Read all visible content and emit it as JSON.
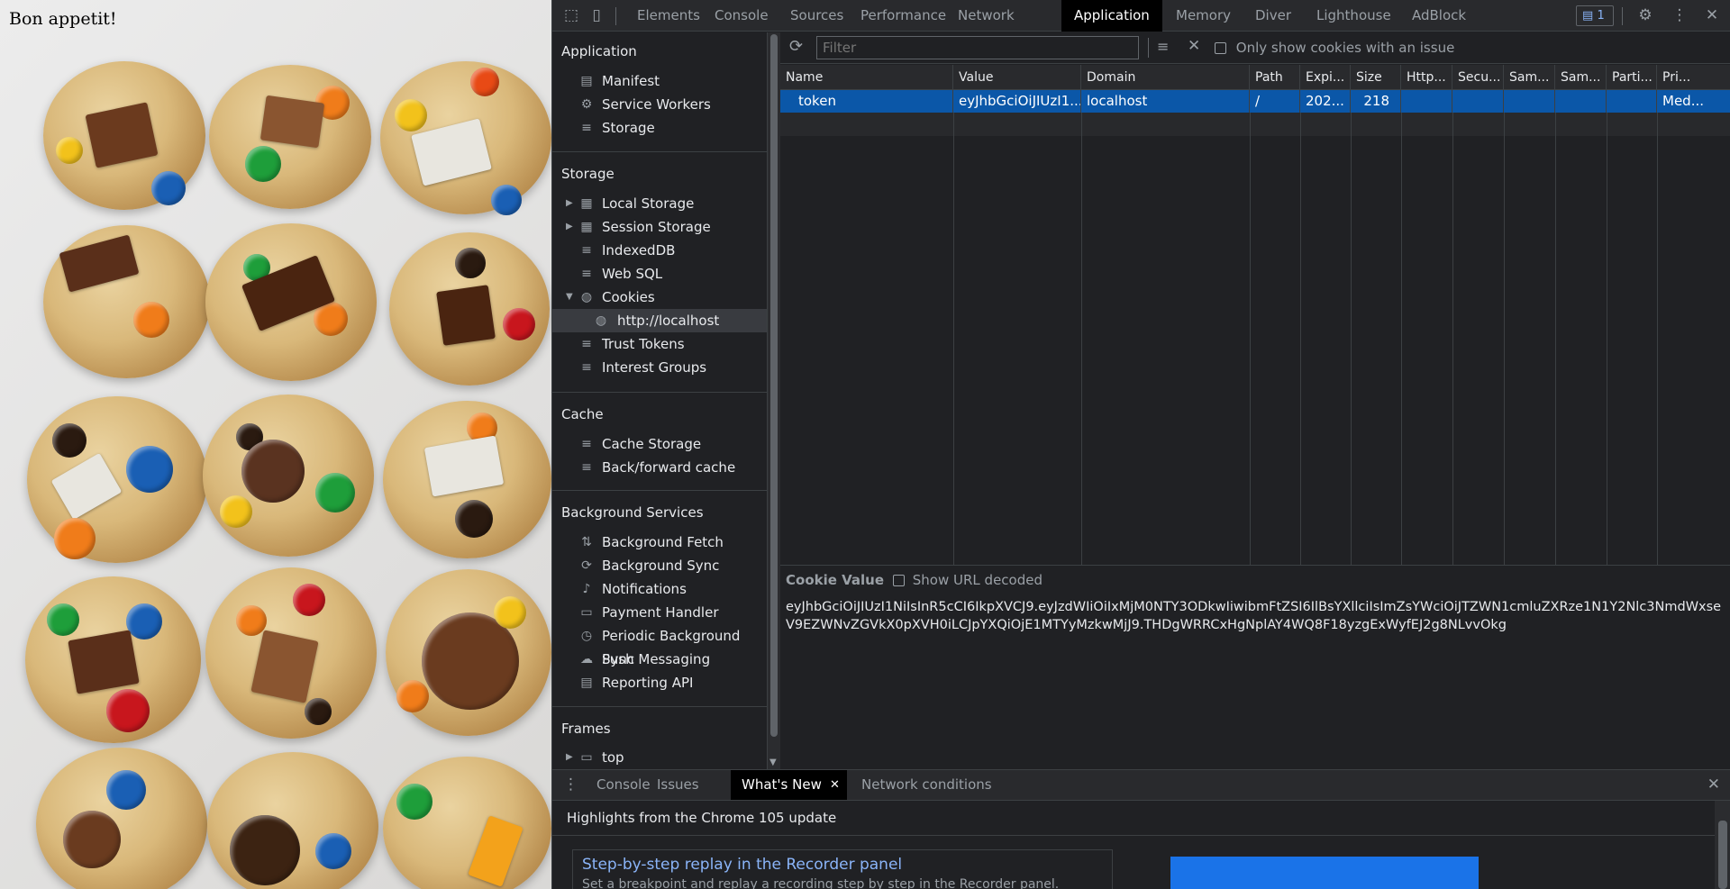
{
  "page": {
    "title": "Bon appetit!"
  },
  "devtools": {
    "tabs": [
      "Elements",
      "Console",
      "Sources",
      "Performance",
      "Network",
      "Application",
      "Memory",
      "Diver",
      "Lighthouse",
      "AdBlock"
    ],
    "active_tab": "Application",
    "issues_count": "1",
    "icons": {
      "inspect": "inspect-cursor-icon",
      "device": "device-toolbar-icon",
      "settings": "gear-icon",
      "more": "kebab-menu-icon",
      "close": "close-icon"
    }
  },
  "sidebar": {
    "sections": {
      "application": "Application",
      "storage": "Storage",
      "cache": "Cache",
      "background_services": "Background Services",
      "frames": "Frames"
    },
    "application_items": [
      {
        "label": "Manifest",
        "icon": "document-icon"
      },
      {
        "label": "Service Workers",
        "icon": "gear-icon"
      },
      {
        "label": "Storage",
        "icon": "database-icon"
      }
    ],
    "storage_items": [
      {
        "label": "Local Storage",
        "icon": "table-icon"
      },
      {
        "label": "Session Storage",
        "icon": "table-icon"
      },
      {
        "label": "IndexedDB",
        "icon": "database-icon"
      },
      {
        "label": "Web SQL",
        "icon": "database-icon"
      },
      {
        "label": "Cookies",
        "icon": "cookie-icon"
      },
      {
        "label": "http://localhost",
        "icon": "cookie-icon"
      },
      {
        "label": "Trust Tokens",
        "icon": "database-icon"
      },
      {
        "label": "Interest Groups",
        "icon": "database-icon"
      }
    ],
    "cache_items": [
      {
        "label": "Cache Storage",
        "icon": "database-icon"
      },
      {
        "label": "Back/forward cache",
        "icon": "database-icon"
      }
    ],
    "bg_items": [
      {
        "label": "Background Fetch",
        "icon": "arrows-updown-icon"
      },
      {
        "label": "Background Sync",
        "icon": "sync-icon"
      },
      {
        "label": "Notifications",
        "icon": "bell-icon"
      },
      {
        "label": "Payment Handler",
        "icon": "card-icon"
      },
      {
        "label": "Periodic Background Sync",
        "icon": "clock-icon"
      },
      {
        "label": "Push Messaging",
        "icon": "cloud-icon"
      },
      {
        "label": "Reporting API",
        "icon": "document-icon"
      }
    ],
    "frames_items": [
      {
        "label": "top",
        "icon": "frame-icon"
      }
    ]
  },
  "cookies": {
    "filter_placeholder": "Filter",
    "only_issues_label": "Only show cookies with an issue",
    "columns": [
      "Name",
      "Value",
      "Domain",
      "Path",
      "Expi...",
      "Size",
      "Http...",
      "Secu...",
      "Sam...",
      "Sam...",
      "Parti...",
      "Pri..."
    ],
    "rows": [
      {
        "name": "token",
        "value": "eyJhbGciOiJIUzI1...",
        "domain": "localhost",
        "path": "/",
        "expires": "202...",
        "size": "218",
        "httponly": "",
        "secure": "",
        "samesite": "",
        "sameparty": "",
        "partition": "",
        "priority": "Med..."
      }
    ],
    "cookie_value_label": "Cookie Value",
    "show_url_decoded_label": "Show URL decoded",
    "cookie_value": "eyJhbGciOiJIUzI1NiIsInR5cCI6IkpXVCJ9.eyJzdWIiOiIxMjM0NTY3ODkwIiwibmFtZSI6IlBsYXllciIsImZsYWciOiJTZWN1cmluZXRze1N1Y2Nlc3NmdWxseV9EZWNvZGVkX0pXVH0iLCJpYXQiOjE1MTYyMzkwMjJ9.THDgWRRCxHgNplAY4WQ8F18yzgExWyfEJ2g8NLvvOkg"
  },
  "drawer": {
    "tabs": [
      "Console",
      "Issues",
      "What's New",
      "Network conditions"
    ],
    "active_tab": "What's New",
    "highlights": "Highlights from the Chrome 105 update",
    "card_title": "Step-by-step replay in the Recorder panel",
    "card_desc": "Set a breakpoint and replay a recording step by step in the Recorder panel."
  }
}
